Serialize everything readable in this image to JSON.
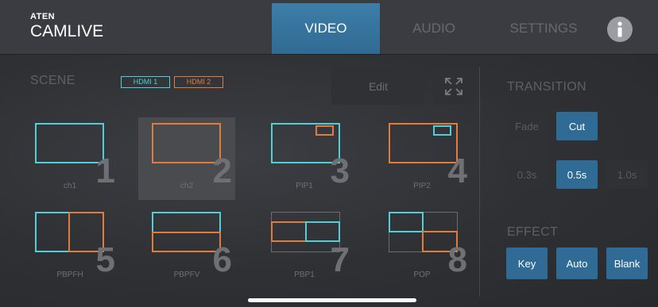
{
  "app": {
    "brand": "ATEN",
    "name": "CAMLIVE"
  },
  "tabs": [
    {
      "label": "VIDEO",
      "active": true
    },
    {
      "label": "AUDIO",
      "active": false
    },
    {
      "label": "SETTINGS",
      "active": false
    }
  ],
  "scene": {
    "title": "SCENE",
    "badges": [
      {
        "label": "HDMI 1",
        "color": "#4fd0d8"
      },
      {
        "label": "HDMI 2",
        "color": "#e07c3c"
      }
    ],
    "edit_label": "Edit",
    "items": [
      {
        "label": "ch1",
        "number": "1",
        "selected": false
      },
      {
        "label": "ch2",
        "number": "2",
        "selected": true
      },
      {
        "label": "PIP1",
        "number": "3",
        "selected": false
      },
      {
        "label": "PIP2",
        "number": "4",
        "selected": false
      },
      {
        "label": "PBPFH",
        "number": "5",
        "selected": false
      },
      {
        "label": "PBPFV",
        "number": "6",
        "selected": false
      },
      {
        "label": "PBP1",
        "number": "7",
        "selected": false
      },
      {
        "label": "POP",
        "number": "8",
        "selected": false
      }
    ]
  },
  "transition": {
    "title": "TRANSITION",
    "modes": [
      {
        "label": "Fade",
        "active": false
      },
      {
        "label": "Cut",
        "active": true
      }
    ],
    "durations": [
      {
        "label": "0.3s",
        "active": false
      },
      {
        "label": "0.5s",
        "active": true
      },
      {
        "label": "1.0s",
        "active": false
      }
    ]
  },
  "effect": {
    "title": "EFFECT",
    "buttons": [
      {
        "label": "Key"
      },
      {
        "label": "Auto"
      },
      {
        "label": "Blank"
      }
    ]
  },
  "colors": {
    "hdmi1": "#4fd0d8",
    "hdmi2": "#e07c3c",
    "accent": "#2f6b94"
  }
}
